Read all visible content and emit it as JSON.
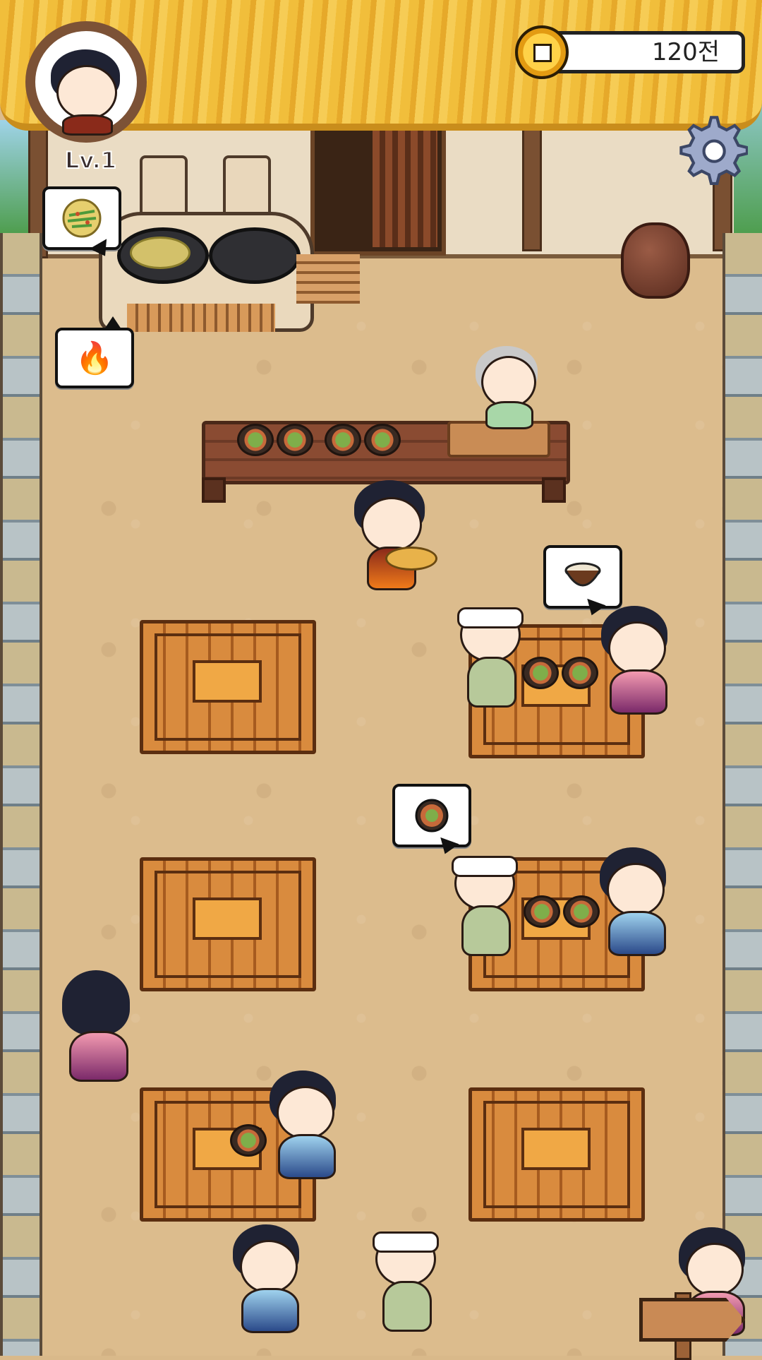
{
  "hud": {
    "level": "Lv.1",
    "coins": "120전",
    "avatar_icon": "elf-waiter-portrait",
    "coin_icon": "square-hole-coin-icon",
    "settings_icon": "gear-icon"
  },
  "orders": {
    "stove_bubble": "pancake",
    "fire_bubble": "🔥",
    "table_right_1_bubble": "rice-bowl",
    "table_right_2_bubble": "noodle-bowl"
  },
  "colors": {
    "roof": "#f1be3b",
    "ground": "#dcbc8d",
    "table": "#d98b3e",
    "coin": "#ffd248"
  }
}
